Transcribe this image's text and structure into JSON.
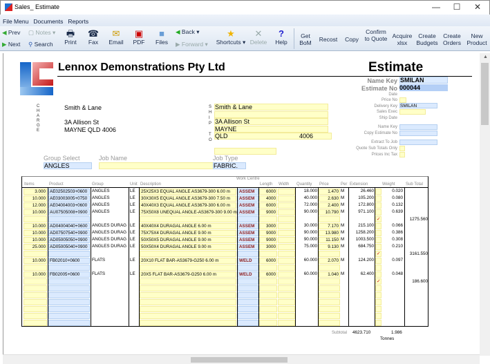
{
  "window": {
    "title": "Sales_ Estimate",
    "minimize": "—",
    "maximize": "☐",
    "close": "✕"
  },
  "menu": [
    "File Menu",
    "Documents",
    "Reports"
  ],
  "toolbar": {
    "prev": "Prev",
    "next": "Next",
    "notes": "Notes",
    "search": "Search",
    "print": "Print",
    "fax": "Fax",
    "email": "Email",
    "pdf": "PDF",
    "files": "Files",
    "back": "Back",
    "forward": "Forward",
    "shortcuts": "Shortcuts",
    "delete": "Delete",
    "help": "Help",
    "get_bom": "Get BoM",
    "recost": "Recost",
    "copy": "Copy",
    "confirm": "Confirm to Quote",
    "acquire": "Acquire xlsx",
    "budgets": "Create Budgets",
    "orders": "Create Orders",
    "new_product": "New Product"
  },
  "header": {
    "company": "Lennox Demonstrations Pty Ltd",
    "doc_title": "Estimate",
    "logo_text": "LC"
  },
  "fields": {
    "name_key_label": "Name Key",
    "name_key": "SMILAN",
    "estimate_no_label": "Estimate No",
    "estimate_no": "000044",
    "date_label": "Date",
    "price_no_label": "Price No",
    "delivery_key_label": "Delivery Key",
    "delivery_key": "SMILAN",
    "sales_exec_label": "Sales Exec",
    "ship_date_label": "Ship Date",
    "name_key2_label": "Name Key",
    "copy_estimate_label": "Copy Estimate No",
    "extract_label": "Extract To Job",
    "quote_sub_label": "Quote Sub Totals Only",
    "prices_inc_label": "Prices Inc Tax"
  },
  "charge": {
    "vlabel": "CHARGE",
    "name": "Smith & Lane",
    "street": "3A Allison St",
    "city": "MAYNE QLD 4006"
  },
  "ship": {
    "vlabel": "SHIP TO",
    "name": "Smith & Lane",
    "street": "3A Allison St",
    "city": "MAYNE",
    "state": "QLD",
    "postcode": "4006"
  },
  "job": {
    "group_select_label": "Group Select",
    "group_select": "ANGLES",
    "job_name_label": "Job Name",
    "job_type_label": "Job Type",
    "job_type": "FABRIC."
  },
  "table": {
    "work_centre_label": "Work Centre",
    "columns": [
      "Items",
      "Product",
      "Group",
      "Unit",
      "Description",
      "Length",
      "Width",
      "Quantity",
      "Price",
      "Per",
      "Extension",
      "Weight",
      "Sub Total"
    ],
    "rows": [
      {
        "items": "3.000",
        "product": "AE02502503+0600",
        "group": "ANGLES",
        "unit": "LE",
        "desc": "25X25X3 EQUAL ANGLE AS3679-300 6.00 m",
        "wc": "ASSEM",
        "length": "6000",
        "qty": "18.000",
        "price": "1.470",
        "per": "M",
        "ext": "26.460",
        "weight": "0.020"
      },
      {
        "items": "10.000",
        "product": "AE03003005+0750",
        "group": "ANGLES",
        "unit": "LE",
        "desc": "30X30X5 EQUAL ANGLE AS3679-300 7.50 m",
        "wc": "ASSEM",
        "length": "4000",
        "qty": "40.000",
        "price": "2.630",
        "per": "M",
        "ext": "105.200",
        "weight": "0.080"
      },
      {
        "items": "12.000",
        "product": "AE04004003+0600",
        "group": "ANGLES",
        "unit": "LE",
        "desc": "40X40X3 EQUAL ANGLE AS3679-300 6.00 m",
        "wc": "ASSEM",
        "length": "6000",
        "qty": "72.000",
        "price": "2.400",
        "per": "M",
        "ext": "172.800",
        "weight": "0.132"
      },
      {
        "items": "10.000",
        "product": "AU07505008+0900",
        "group": "ANGLES",
        "unit": "LE",
        "desc": "75X50X8 UNEQUAL ANGLE-AS3679-300 9.00 m",
        "wc": "ASSEM",
        "length": "9000",
        "qty": "90.000",
        "price": "10.790",
        "per": "M",
        "ext": "971.100",
        "weight": "0.639"
      },
      {
        "subtotal": "1275.560"
      },
      {
        "items": "10.000",
        "product": "AD04004040+0600",
        "group": "ANGLES DURAG",
        "unit": "LE",
        "desc": "40X40X4 DURAGAL ANGLE 6.00 m",
        "wc": "ASSEM",
        "length": "3000",
        "qty": "30.000",
        "price": "7.170",
        "per": "M",
        "ext": "215.100",
        "weight": "0.066"
      },
      {
        "items": "10.000",
        "product": "AD07507540+0900",
        "group": "ANGLES DURAG",
        "unit": "LE",
        "desc": "75X75X4 DURAGAL ANGLE 9.00 m",
        "wc": "ASSEM",
        "length": "9000",
        "qty": "90.000",
        "price": "13.980",
        "per": "M",
        "ext": "1258.200",
        "weight": "0.386"
      },
      {
        "items": "10.000",
        "product": "AD05005050+0900",
        "group": "ANGLES DURAG",
        "unit": "LE",
        "desc": "50X50X5 DURAGAL ANGLE 9.00 m",
        "wc": "ASSEM",
        "length": "9000",
        "qty": "90.000",
        "price": "11.150",
        "per": "M",
        "ext": "1003.500",
        "weight": "0.308"
      },
      {
        "items": "25.000",
        "product": "AD05005040+0900",
        "group": "ANGLES DURAG",
        "unit": "LE",
        "desc": "50X50X4 DURAGAL ANGLE 9.00 m",
        "wc": "ASSEM",
        "length": "3000",
        "qty": "75.000",
        "price": "9.130",
        "per": "M",
        "ext": "684.750",
        "weight": "0.210"
      },
      {
        "subtotal": "3161.550"
      },
      {
        "items": "10.000",
        "product": "FB02010+0600",
        "group": "FLATS",
        "unit": "LE",
        "desc": "20X10 FLAT BAR-AS3679-G250 6.00 m",
        "wc": "WELD",
        "length": "6000",
        "qty": "60.000",
        "price": "2.070",
        "per": "M",
        "ext": "124.200",
        "weight": "0.097"
      },
      {},
      {
        "items": "10.000",
        "product": "FB02005+0600",
        "group": "FLATS",
        "unit": "LE",
        "desc": "20X5 FLAT BAR-AS3679-G250 6.00 m",
        "wc": "WELD",
        "length": "6000",
        "qty": "60.000",
        "price": "1.040",
        "per": "M",
        "ext": "62.400",
        "weight": "0.048"
      },
      {
        "subtotal": "186.600"
      }
    ],
    "subtotal_label": "Subtotal",
    "subtotal_ext": "4623.710",
    "subtotal_weight": "1.986",
    "weight_unit": "Tonnes"
  },
  "colors": {
    "field_yellow": "#ffffc8",
    "field_blue": "#dbeafe",
    "work_centre_text": "#8b1a1a"
  }
}
